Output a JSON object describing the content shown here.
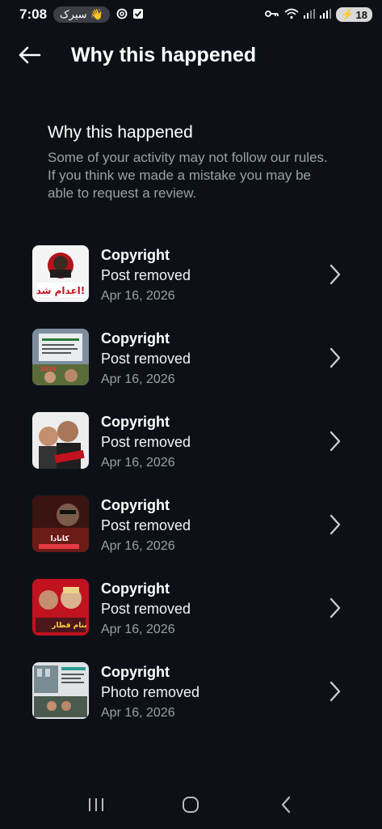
{
  "status_bar": {
    "time": "7:08",
    "pill_label": "سیرک",
    "battery": "18"
  },
  "header": {
    "title": "Why this happened"
  },
  "info": {
    "title": "Why this happened",
    "description": "Some of your activity may not follow our rules. If you think we made a mistake you may be able to request a review."
  },
  "items": [
    {
      "type": "Copyright",
      "status": "Post removed",
      "date": "Apr 16, 2026",
      "thumb_text": "اعدام شد!"
    },
    {
      "type": "Copyright",
      "status": "Post removed",
      "date": "Apr 16, 2026",
      "thumb_text": "2026"
    },
    {
      "type": "Copyright",
      "status": "Post removed",
      "date": "Apr 16, 2026",
      "thumb_text": ""
    },
    {
      "type": "Copyright",
      "status": "Post removed",
      "date": "Apr 16, 2026",
      "thumb_text": "کانادا"
    },
    {
      "type": "Copyright",
      "status": "Post removed",
      "date": "Apr 16, 2026",
      "thumb_text": "بنام قطار"
    },
    {
      "type": "Copyright",
      "status": "Photo removed",
      "date": "Apr 16, 2026",
      "thumb_text": ""
    }
  ],
  "colors": {
    "background": "#0d1117",
    "text_primary": "#ffffff",
    "text_secondary": "#9aa0a6"
  }
}
